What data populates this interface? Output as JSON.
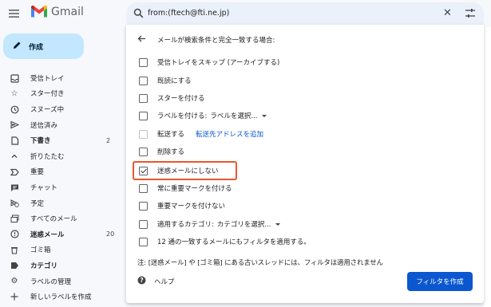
{
  "app": {
    "logo_text": "Gmail"
  },
  "search": {
    "query": "from:(ftech@fti.ne.jp)"
  },
  "compose": {
    "label": "作成"
  },
  "nav": [
    {
      "label": "受信トレイ",
      "icon": "inbox-icon",
      "bold": false,
      "count": ""
    },
    {
      "label": "スター付き",
      "icon": "star-icon",
      "bold": false,
      "count": ""
    },
    {
      "label": "スヌーズ中",
      "icon": "clock-icon",
      "bold": false,
      "count": ""
    },
    {
      "label": "送信済み",
      "icon": "send-icon",
      "bold": false,
      "count": ""
    },
    {
      "label": "下書き",
      "icon": "draft-icon",
      "bold": true,
      "count": "2"
    },
    {
      "label": "折りたたむ",
      "icon": "chevron-up-icon",
      "bold": false,
      "count": ""
    },
    {
      "label": "重要",
      "icon": "important-icon",
      "bold": false,
      "count": ""
    },
    {
      "label": "チャット",
      "icon": "chat-icon",
      "bold": false,
      "count": ""
    },
    {
      "label": "予定",
      "icon": "scheduled-icon",
      "bold": false,
      "count": ""
    },
    {
      "label": "すべてのメール",
      "icon": "all-mail-icon",
      "bold": false,
      "count": ""
    },
    {
      "label": "迷惑メール",
      "icon": "spam-icon",
      "bold": true,
      "count": "20"
    },
    {
      "label": "ゴミ箱",
      "icon": "trash-icon",
      "bold": false,
      "count": ""
    },
    {
      "label": "カテゴリ",
      "icon": "label-icon",
      "bold": true,
      "count": ""
    },
    {
      "label": "ラベルの管理",
      "icon": "gear-icon",
      "bold": false,
      "count": ""
    },
    {
      "label": "新しいラベルを作成",
      "icon": "plus-icon",
      "bold": false,
      "count": ""
    }
  ],
  "filter": {
    "heading": "メールが検索条件と完全一致する場合:",
    "options": {
      "skip_inbox": "受信トレイをスキップ (アーカイブする)",
      "mark_read": "既読にする",
      "star": "スターを付ける",
      "apply_label": "ラベルを付ける:",
      "label_select": "ラベルを選択...",
      "forward": "転送する",
      "forward_link": "転送先アドレスを追加",
      "delete": "削除する",
      "never_spam": "迷惑メールにしない",
      "always_important": "常に重要マークを付ける",
      "never_important": "重要マークを付けない",
      "categorize": "適用するカテゴリ:",
      "category_select": "カテゴリを選択...",
      "also_apply": "12 通の一致するメールにもフィルタを適用する。"
    },
    "checked": {
      "never_spam": true
    },
    "note": "注: [迷惑メール] や [ゴミ箱] にある古いスレッドには、フィルタは適用されません",
    "help": "ヘルプ",
    "create_button": "フィルタを作成"
  },
  "colors": {
    "accent": "#0b57d0",
    "compose_bg": "#c2e7ff",
    "highlight": "#e9572b"
  }
}
